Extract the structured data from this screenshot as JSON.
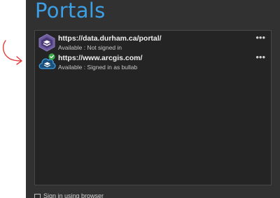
{
  "panel": {
    "title": "Portals"
  },
  "portals": [
    {
      "url": "https://data.durham.ca/portal/",
      "status": "Available : Not signed in",
      "icon": "portal-hexagon-icon",
      "more": "•••"
    },
    {
      "url": "https://www.arcgis.com/",
      "status": "Available : Signed in as bullab",
      "icon": "arcgis-online-cloud-icon",
      "signed_in_badge": "check-badge-icon",
      "more": "•••"
    }
  ],
  "footer": {
    "checkbox_label": "Sign in using browser",
    "checked": false
  },
  "colors": {
    "accent": "#3d9fe4",
    "panel_bg": "#313131",
    "list_bg": "#242424",
    "signed_in": "#3aa84a",
    "annotation": "#e23b3b"
  }
}
